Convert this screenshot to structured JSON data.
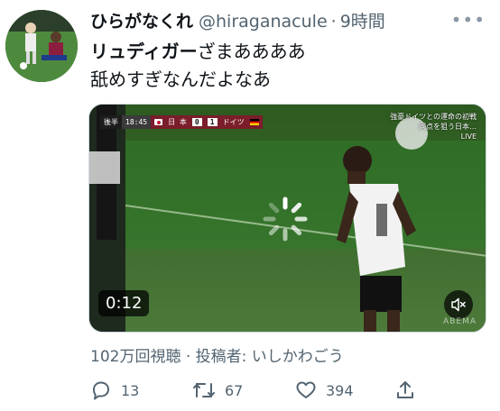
{
  "author": {
    "display_name": "ひらがなくれ",
    "handle": "@hiraganacule",
    "separator": "·",
    "time": "9時間"
  },
  "more_label": "•••",
  "tweet": {
    "line1_mention": "リュディガー",
    "line1_rest": "ざまああああ",
    "line2": "舐めすぎなんだよなあ"
  },
  "media": {
    "scoreboard": {
      "half": "後半",
      "clock": "18:45",
      "home_team": "日 本",
      "home_score": "0",
      "away_score": "1",
      "away_team": "ドイツ"
    },
    "overlay_line1": "強豪ドイツとの運命の初戦",
    "overlay_line2": "同点を狙う日本…",
    "overlay_live": "LIVE",
    "duration": "0:12",
    "watermark": "ABEMA",
    "mute_icon": "mute-icon"
  },
  "views_text": "102万回視聴 · 投稿者: いしかわごう",
  "actions": {
    "reply_count": "13",
    "retweet_count": "67",
    "like_count": "394"
  },
  "colors": {
    "text": "#0f1419",
    "muted": "#536471",
    "pitch": "#3f6b33"
  }
}
